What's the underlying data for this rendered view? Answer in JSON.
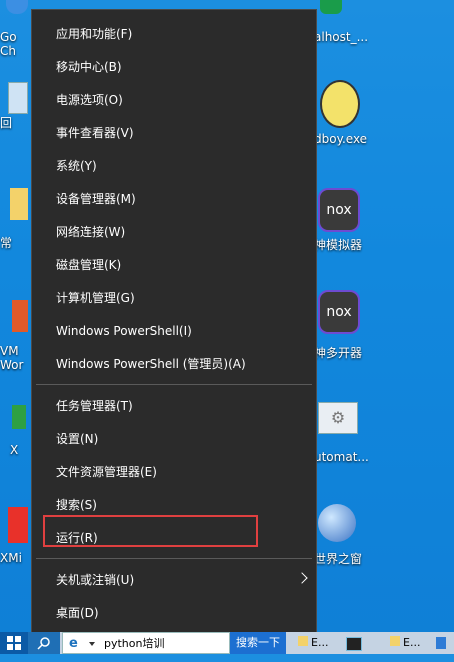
{
  "desktop": {
    "left_labels": [
      "Go",
      "Ch",
      "回",
      "常",
      "VM",
      "Wor",
      "X",
      "XMi"
    ],
    "right_labels": [
      "alhost_...",
      "dboy.exe",
      "神模拟器",
      "神多开器",
      "utomat...",
      "世界之窗"
    ],
    "nox_text": "nox"
  },
  "menu": {
    "items": [
      {
        "label": "应用和功能(F)"
      },
      {
        "label": "移动中心(B)"
      },
      {
        "label": "电源选项(O)"
      },
      {
        "label": "事件查看器(V)"
      },
      {
        "label": "系统(Y)"
      },
      {
        "label": "设备管理器(M)"
      },
      {
        "label": "网络连接(W)"
      },
      {
        "label": "磁盘管理(K)"
      },
      {
        "label": "计算机管理(G)"
      },
      {
        "label": "Windows PowerShell(I)"
      },
      {
        "label": "Windows PowerShell (管理员)(A)"
      },
      {
        "label": "任务管理器(T)"
      },
      {
        "label": "设置(N)"
      },
      {
        "label": "文件资源管理器(E)"
      },
      {
        "label": "搜索(S)"
      },
      {
        "label": "运行(R)"
      },
      {
        "label": "关机或注销(U)"
      },
      {
        "label": "桌面(D)"
      }
    ]
  },
  "taskbar": {
    "search_text": "python培训",
    "search_button": "搜索一下",
    "task_e1": "E...",
    "task_e2": "E..."
  },
  "colors": {
    "menu_bg": "#2b2b2b",
    "highlight_border": "#e04040",
    "desktop_bg": "#1288dd"
  }
}
